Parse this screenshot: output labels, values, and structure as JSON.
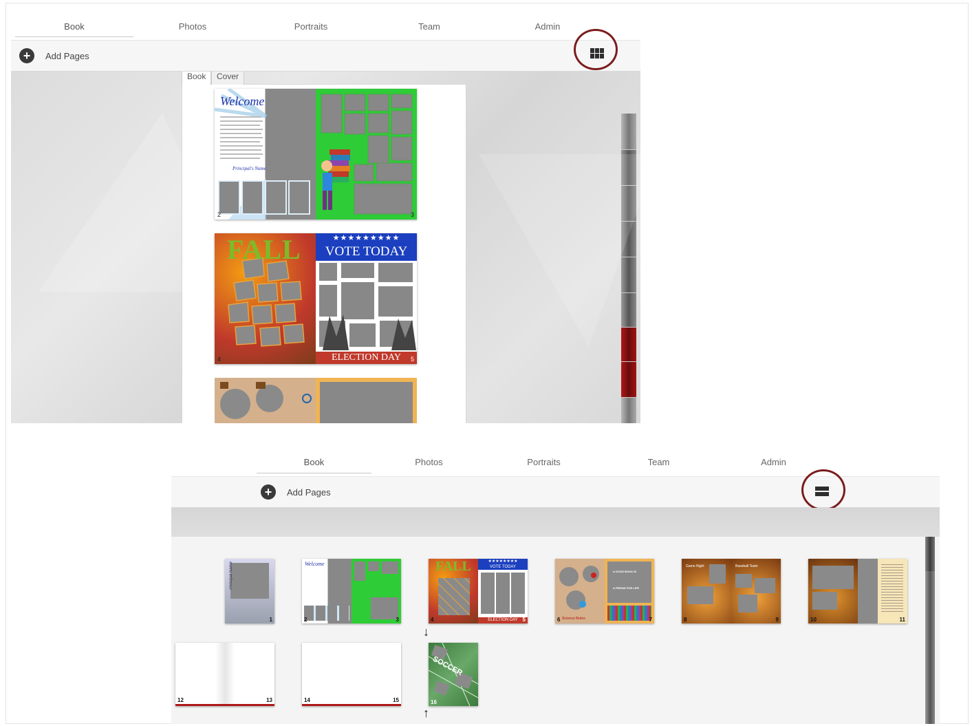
{
  "panel1": {
    "nav": {
      "tabs": [
        "Book",
        "Photos",
        "Portraits",
        "Team",
        "Admin"
      ],
      "active": "Book"
    },
    "toolbar": {
      "add_pages_label": "Add Pages",
      "view_icon": "grid-view-icon"
    },
    "panel_tabs": [
      "Book",
      "Cover"
    ],
    "spreads": [
      {
        "left_title": "Welcome",
        "left_signature": "Principal's Name",
        "left_num": "2",
        "right_num": "3"
      },
      {
        "left_title": "FALL",
        "right_title": "VOTE TODAY",
        "right_footer": "ELECTION DAY",
        "left_num": "4",
        "right_num": "5"
      }
    ]
  },
  "panel2": {
    "nav": {
      "tabs": [
        "Book",
        "Photos",
        "Portraits",
        "Team",
        "Admin"
      ],
      "active": "Book"
    },
    "toolbar": {
      "add_pages_label": "Add Pages",
      "view_icon": "list-view-icon"
    },
    "thumbs": [
      {
        "nums": [
          "",
          "1"
        ],
        "label": "Principal Name"
      },
      {
        "nums": [
          "2",
          "3"
        ],
        "label": "Welcome"
      },
      {
        "nums": [
          "4",
          "5"
        ],
        "label": "FALL",
        "label2": "VOTE TODAY",
        "label3": "ELECTION DAY"
      },
      {
        "nums": [
          "6",
          "7"
        ],
        "label": "A GOOD BOOK IS",
        "label2": "A FRIEND FOR LIFE",
        "label3": "Science Rules"
      },
      {
        "nums": [
          "8",
          "9"
        ],
        "label": "Game Night",
        "label2": "Baseball Team"
      },
      {
        "nums": [
          "10",
          "11"
        ]
      },
      {
        "nums": [
          "12",
          "13"
        ]
      },
      {
        "nums": [
          "14",
          "15"
        ]
      },
      {
        "nums": [
          "16",
          ""
        ],
        "label": "SOCCER"
      }
    ]
  },
  "colors": {
    "accent_ring": "#7a1c1c",
    "scroll_red": "#b01818"
  }
}
